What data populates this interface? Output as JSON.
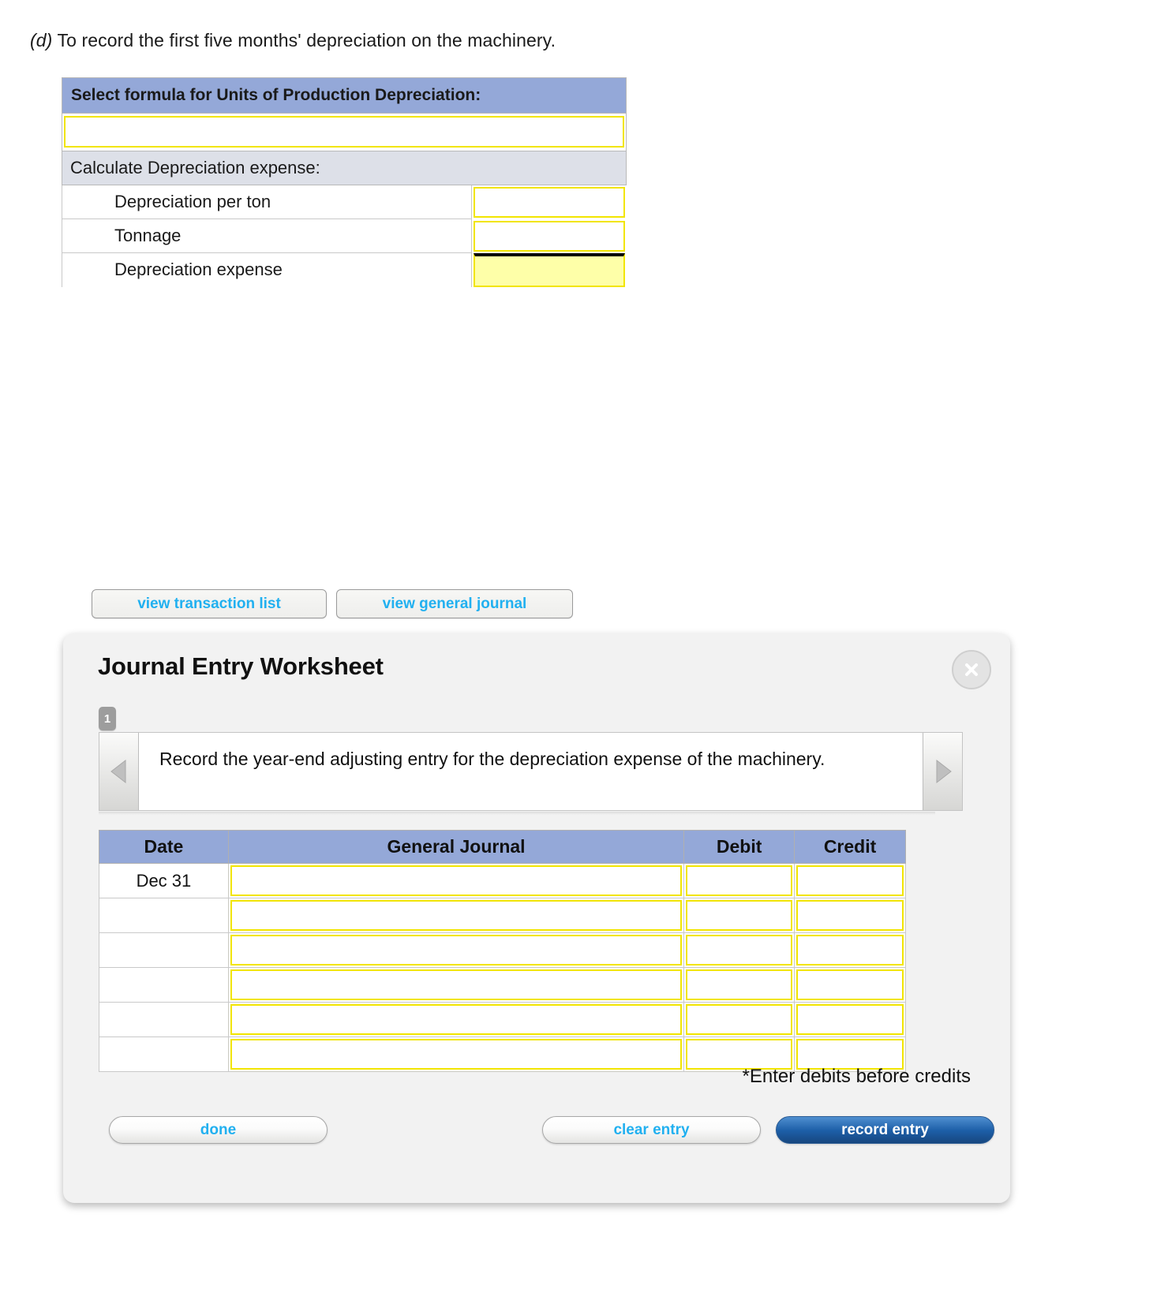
{
  "prompt": {
    "letter": "(d)",
    "text": " To record the first five months' depreciation on the machinery."
  },
  "uop": {
    "header": "Select formula for Units of Production Depreciation:",
    "formula_value": "",
    "subheader": "Calculate Depreciation expense:",
    "rows": [
      {
        "label": "Depreciation per ton",
        "value": ""
      },
      {
        "label": "Tonnage",
        "value": ""
      },
      {
        "label": "Depreciation expense",
        "value": ""
      }
    ]
  },
  "view_buttons": {
    "transaction_list": "view transaction list",
    "general_journal": "view general journal"
  },
  "worksheet": {
    "title": "Journal Entry Worksheet",
    "close_label": "X",
    "step_number": "1",
    "instruction": "Record the year-end adjusting entry for the depreciation expense of the machinery.",
    "table": {
      "columns": [
        "Date",
        "General Journal",
        "Debit",
        "Credit"
      ],
      "rows": [
        {
          "date": "Dec 31",
          "account": "",
          "debit": "",
          "credit": ""
        },
        {
          "date": "",
          "account": "",
          "debit": "",
          "credit": ""
        },
        {
          "date": "",
          "account": "",
          "debit": "",
          "credit": ""
        },
        {
          "date": "",
          "account": "",
          "debit": "",
          "credit": ""
        },
        {
          "date": "",
          "account": "",
          "debit": "",
          "credit": ""
        },
        {
          "date": "",
          "account": "",
          "debit": "",
          "credit": ""
        }
      ]
    },
    "note": "*Enter debits before credits",
    "buttons": {
      "done": "done",
      "clear_entry": "clear entry",
      "record_entry": "record entry"
    }
  },
  "colors": {
    "header_blue": "#94a8d8",
    "input_yellow": "#f2e500",
    "total_fill": "#feffa8",
    "link_blue": "#21b0f0",
    "record_blue": "#1d5fa8"
  }
}
